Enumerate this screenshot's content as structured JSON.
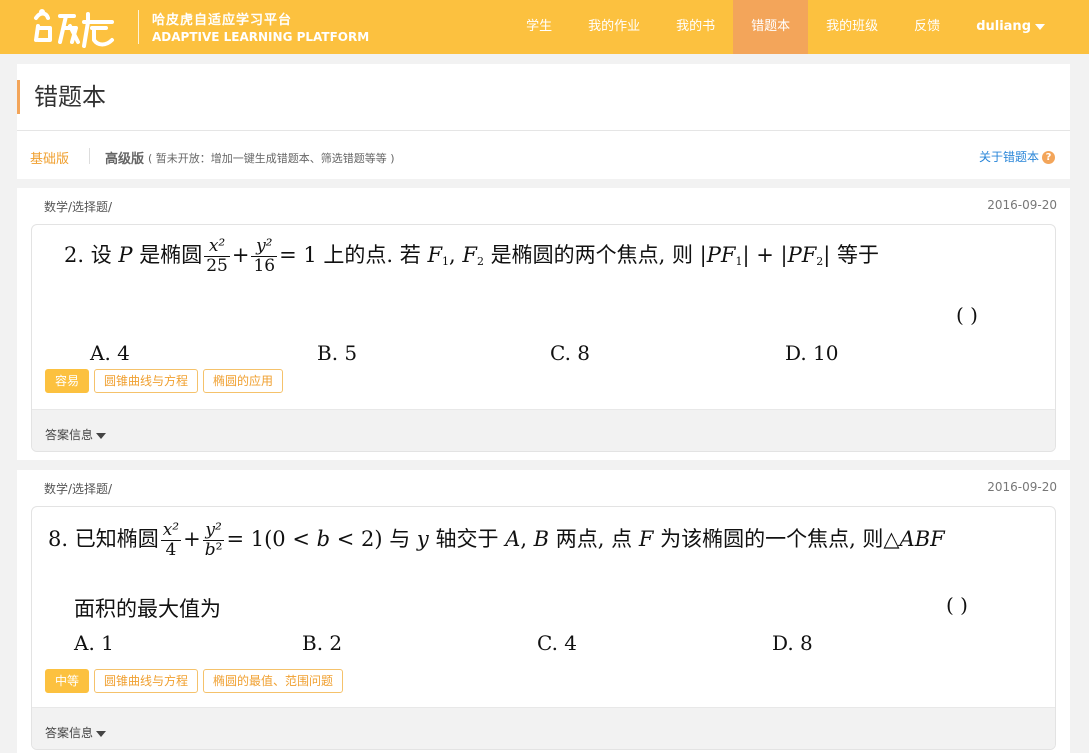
{
  "header": {
    "brand_cn": "哈皮虎自适应学习平台",
    "brand_en": "ADAPTIVE LEARNING PLATFORM",
    "nav": [
      {
        "label": "学生",
        "active": false
      },
      {
        "label": "我的作业",
        "active": false
      },
      {
        "label": "我的书",
        "active": false
      },
      {
        "label": "错题本",
        "active": true
      },
      {
        "label": "我的班级",
        "active": false
      },
      {
        "label": "反馈",
        "active": false
      }
    ],
    "user": "duliang",
    "colors": {
      "bar": "#fcc13f",
      "active": "#f3a55a"
    }
  },
  "page": {
    "title": "错题本",
    "mode_basic": "基础版",
    "mode_advanced": "高级版",
    "mode_note": "( 暂未开放：增加一键生成错题本、筛选错题等等 )",
    "about_link": "关于错题本",
    "about_icon": "question-circle-icon"
  },
  "questions": [
    {
      "category": "数学/选择题/",
      "date": "2016-09-20",
      "stem": "2. 设 P 是椭圆 x²/25 + y²/16 = 1 上的点. 若 F₁, F₂ 是椭圆的两个焦点, 则 |PF₁| + |PF₂| 等于",
      "parens": "(        )",
      "options": [
        "A. 4",
        "B. 5",
        "C. 8",
        "D. 10"
      ],
      "level": "容易",
      "tags": [
        "圆锥曲线与方程",
        "椭圆的应用"
      ],
      "answer_label": "答案信息"
    },
    {
      "category": "数学/选择题/",
      "date": "2016-09-20",
      "stem": "8. 已知椭圆 x²/4 + y²/b² = 1 (0<b<2) 与 y 轴交于 A, B 两点, 点 F 为该椭圆的一个焦点, 则 △ABF 面积的最大值为",
      "parens": "(        )",
      "options": [
        "A. 1",
        "B. 2",
        "C. 4",
        "D. 8"
      ],
      "level": "中等",
      "tags": [
        "圆锥曲线与方程",
        "椭圆的最值、范围问题"
      ],
      "answer_label": "答案信息"
    }
  ]
}
